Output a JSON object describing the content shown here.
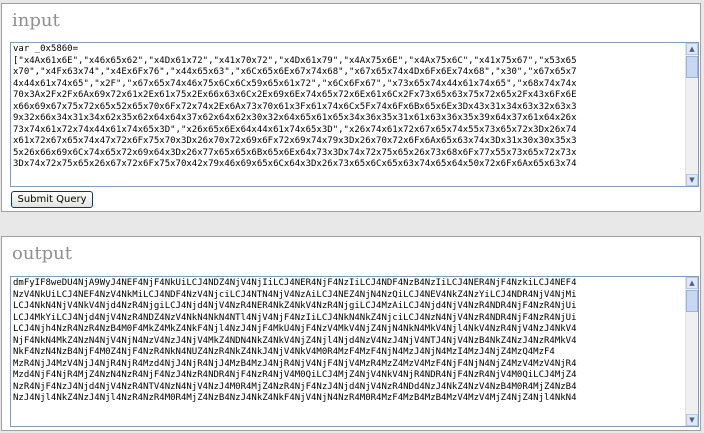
{
  "input": {
    "title": "input",
    "code_lines": [
      "var _0x5860=",
      "[\"x4Ax61x6E\",\"x46x65x62\",\"x4Dx61x72\",\"x41x70x72\",\"x4Dx61x79\",\"x4Ax75x6E\",\"x4Ax75x6C\",\"x41x75x67\",\"x53x65",
      "x70\",\"x4Fx63x74\",\"x4Ex6Fx76\",\"x44x65x63\",\"x6Cx65x6Ex67x74x68\",\"x67x65x74x4Dx6Fx6Ex74x68\",\"x30\",\"x67x65x7",
      "4x44x61x74x65\",\"x2F\",\"x67x65x74x46x75x6Cx6Cx59x65x61x72\",\"x6Cx6Fx67\",\"x73x65x74x44x61x74x65\",\"x68x74x74x",
      "70x3Ax2Fx2Fx6Ax69x72x61x2Ex61x75x2Ex66x63x6Cx2Ex69x6Ex74x65x72x6Ex61x6Cx2Fx73x65x63x75x72x65x2Fx43x6Fx6E",
      "x66x69x67x75x72x65x52x65x70x6Fx72x74x2Ex6Ax73x70x61x3Fx61x74x6Cx5Fx74x6Fx6Bx65x6Ex3Dx43x31x34x63x32x63x3",
      "9x32x66x34x31x34x62x35x62x64x64x37x62x64x62x30x32x64x65x61x65x34x36x35x31x61x63x36x35x39x64x37x61x64x26x",
      "73x74x61x72x74x44x61x74x65x3D\",\"x26x65x6Ex64x44x61x74x65x3D\",\"x26x74x61x72x67x65x74x55x73x65x72x3Dx26x74",
      "x61x72x67x65x74x47x72x6Fx75x70x3Dx26x70x72x69x6Fx72x69x74x79x3Dx26x70x72x6Fx6Ax65x63x74x3Dx31x30x30x35x3",
      "5x26x66x69x6Cx74x65x72x69x64x3Dx26x77x65x65x6Bx65x6Ex64x73x3Dx74x72x75x65x26x73x68x6Fx77x55x73x65x72x73x",
      "3Dx74x72x75x65x26x67x72x6Fx75x70x42x79x46x69x65x6Cx64x3Dx26x73x65x6Cx65x63x74x65x64x50x72x6Fx6Ax65x63x74"
    ],
    "submit_label": "Submit Query"
  },
  "output": {
    "title": "output",
    "code_lines": [
      "dmFyIF8weDU4NjA9WyJ4NEF4NjF4NkUiLCJ4NDZ4NjV4NjIiLCJ4NER4NjF4NzIiLCJ4NDF4NzB4NzIiLCJ4NER4NjF4NzkiLCJ4NEF4",
      "NzV4NkUiLCJ4NEF4NzV4NkMiLCJ4NDF4NzV4NjciLCJ4NTN4NjV4NzAiLCJ4NEZ4NjN4NzQiLCJ4NEV4NkZ4NzYiLCJ4NDR4NjV4NjMi",
      "LCJ4NkN4NjV4NkV4Njd4NzR4NjgiLCJ4Njd4NjV4NzR4NER4NkZ4NkV4NzR4NjgiLCJ4MzAiLCJ4Njd4NjV4NzR4NDR4NjF4NzR4NjUi",
      "LCJ4MkYiLCJ4Njd4NjV4NzR4NDZ4NzV4NkN4NkN4NTl4NjV4NjF4NzIiLCJ4NkN4NkZ4NjciLCJ4NzN4NjV4NzR4NDR4NjF4NzR4NjUi",
      "LCJ4Njh4NzR4NzR4NzB4M0F4MkZ4MkZ4NkF4Njl4NzJ4NjF4MkU4NjF4NzV4MkV4NjZ4NjN4NkN4MkV4Njl4NkV4NzR4NjV4NzJ4NkV4",
      "NjF4NkN4MkZ4NzN4NjV4NjN4NzV4NzJ4NjV4MkZ4NDN4NkZ4NkV4NjZ4Njl4Njd4NzV4NzJ4NjV4NTJ4NjV4NzB4NkZ4NzJ4NzR4MkV4",
      "NkF4NzN4NzB4NjF4M0Z4NjF4NzR4NkN4NUZ4NzR4NkZ4NkJ4NjV4NkV4M0R4MzF4MzF4NjN4MzJ4NjN4MzI4MzJ4NjZ4MzQ4MzF4",
      "MzR4NjJ4MzV4NjJ4NjR4NjR4Mzd4NjJ4NjR4NjJ4MzB4MzJ4NjR4NjV4NjF4NjV4MzR4MzZ4MzV4MzF4NjF4NjN4NjZ4MzV4MzV4NjR4",
      "Mzd4NjF4NjR4MjZ4NzN4NzR4NjF4NzJ4NzR4NDR4NjF4NzR4NjV4M0QiLCJ4MjZ4NjV4NkV4NjR4NDR4NjF4NzR4NjV4M0QiLCJ4MjZ4",
      "NzR4NjF4NzJ4Njd4NjV4NzR4NTV4NzN4NjV4NzJ4M0R4MjZ4NzR4NjF4NzJ4Njd4NjV4NzR4NDd4NzJ4NkZ4NzV4NzB4M0R4MjZ4NzB4",
      "NzJ4Njl4NkZ4NzJ4Njl4NzR4NzR4M0R4MjZ4NzB4NzJ4NkZ4NkF4NjV4NjN4NzR4M0R4MzF4MzB4MzB4MzV4MzV4MjZ4NjZ4Njl4NkN4"
    ]
  },
  "scrollbar_icons": {
    "up": "scroll-up-arrow-icon",
    "down": "scroll-down-arrow-icon"
  }
}
